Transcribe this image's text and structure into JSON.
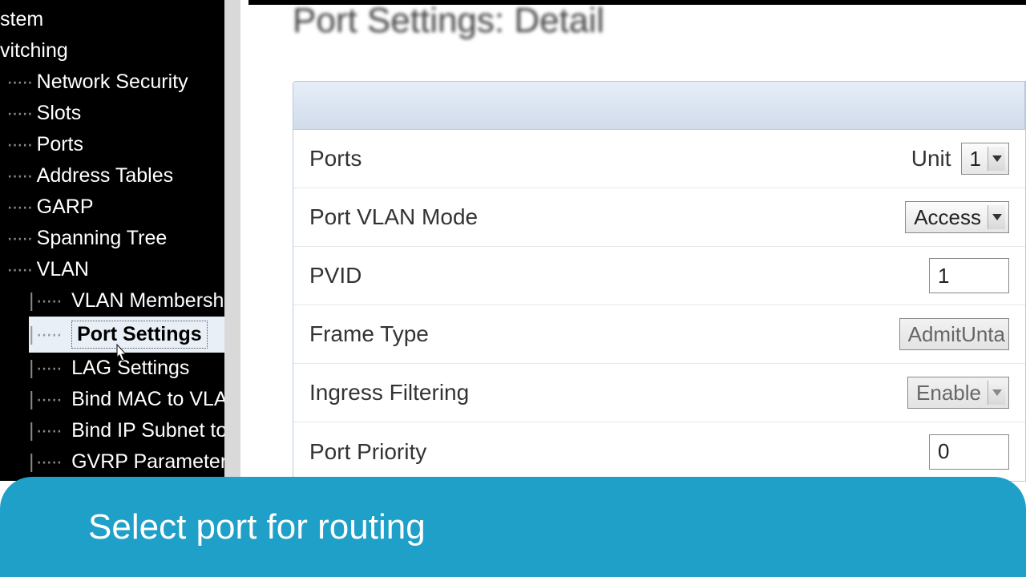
{
  "sidebar": {
    "top": [
      "stem",
      "vitching"
    ],
    "items": [
      "Network Security",
      "Slots",
      "Ports",
      "Address Tables",
      "GARP",
      "Spanning Tree",
      "VLAN"
    ],
    "vlan_children": [
      "VLAN Membership",
      "Port Settings",
      "LAG Settings",
      "Bind MAC to VLAN",
      "Bind IP Subnet to V",
      "GVRP Parameters"
    ],
    "active_child_index": 1
  },
  "page_title": "Port Settings: Detail",
  "form": {
    "rows": [
      {
        "label": "Ports",
        "unit_label": "Unit",
        "value": "1",
        "type": "select"
      },
      {
        "label": "Port VLAN Mode",
        "value": "Access",
        "type": "select"
      },
      {
        "label": "PVID",
        "value": "1",
        "type": "text"
      },
      {
        "label": "Frame Type",
        "value": "AdmitUnta",
        "type": "select-disabled"
      },
      {
        "label": "Ingress Filtering",
        "value": "Enable",
        "type": "select-disabled"
      },
      {
        "label": "Port Priority",
        "value": "0",
        "type": "text"
      }
    ]
  },
  "banner": "Select port for routing"
}
